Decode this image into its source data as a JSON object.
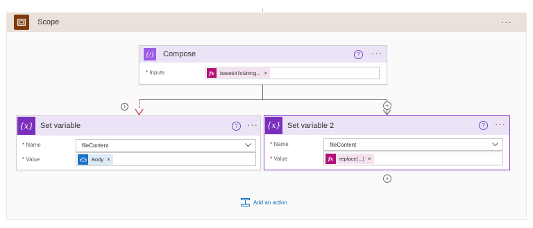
{
  "scope": {
    "title": "Scope",
    "more": "···"
  },
  "compose": {
    "title": "Compose",
    "icon": "{/}",
    "help": "?",
    "more": "···",
    "inputs_label": "Inputs",
    "inputs_token": "base64ToString...",
    "token_remove": "×"
  },
  "set_variable_1": {
    "title": "Set variable",
    "icon": "{x}",
    "help": "?",
    "more": "···",
    "name_label": "Name",
    "name_value": "fileContent",
    "value_label": "Value",
    "value_token": "Body",
    "token_remove": "×"
  },
  "set_variable_2": {
    "title": "Set variable 2",
    "icon": "{x}",
    "help": "?",
    "more": "···",
    "name_label": "Name",
    "name_value": "fileContent",
    "value_label": "Value",
    "value_token": "replace(...)",
    "token_remove": "×"
  },
  "connector": {
    "info": "i",
    "plus": "+"
  },
  "add_action": {
    "label": "Add an action"
  },
  "colors": {
    "scope_header": "#eae1da",
    "scope_icon": "#7f3b0c",
    "variable_purple": "#7b2fbe",
    "expression_pink": "#b4117a",
    "dynamic_blue": "#1a73c7",
    "selected_border": "#8a3fd1",
    "error_arrow": "#c4314b"
  }
}
